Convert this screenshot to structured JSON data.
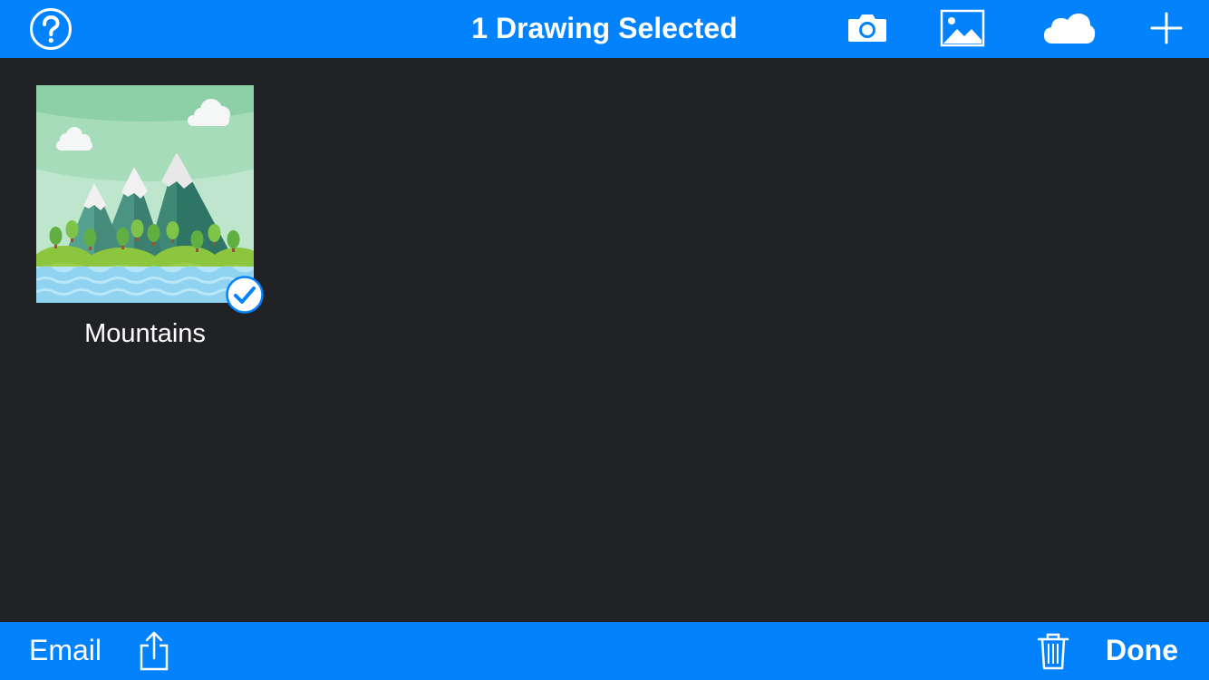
{
  "header": {
    "title": "1 Drawing Selected",
    "icons": [
      "help-icon",
      "camera-icon",
      "photo-icon",
      "cloud-icon",
      "plus-icon"
    ]
  },
  "gallery": {
    "items": [
      {
        "name": "Mountains",
        "selected": true,
        "thumbnail": "mountain-landscape"
      }
    ]
  },
  "footer": {
    "email_label": "Email",
    "done_label": "Done",
    "icons": [
      "share-icon",
      "trash-icon"
    ]
  },
  "colors": {
    "accent": "#0283fd",
    "background": "#212226",
    "text": "#ffffff"
  }
}
